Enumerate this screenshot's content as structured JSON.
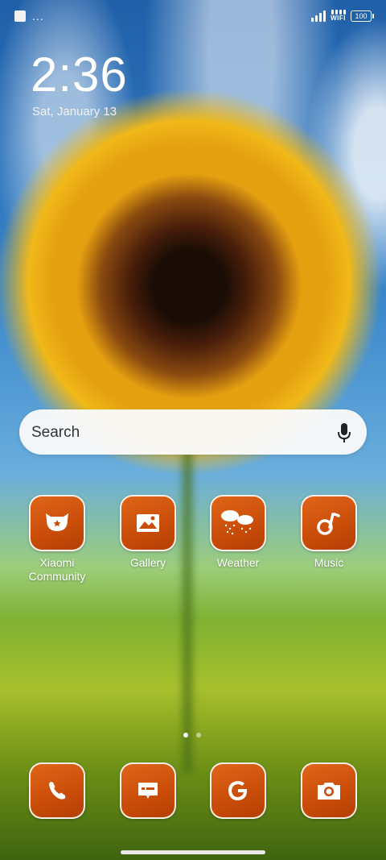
{
  "status_bar": {
    "left_dots": "...",
    "wifi_label": "WIFI",
    "battery_level": "100"
  },
  "lock": {
    "time": "2:36",
    "date": "Sat, January 13"
  },
  "search": {
    "placeholder": "Search",
    "icon": "mic-icon"
  },
  "apps": [
    {
      "label": "Xiaomi\nCommunity",
      "icon": "xiaomi-community-icon"
    },
    {
      "label": "Gallery",
      "icon": "gallery-icon"
    },
    {
      "label": "Weather",
      "icon": "weather-icon"
    },
    {
      "label": "Music",
      "icon": "music-icon"
    }
  ],
  "dock": [
    {
      "name": "Phone",
      "icon": "phone-icon"
    },
    {
      "name": "Messages",
      "icon": "messages-icon"
    },
    {
      "name": "Google",
      "icon": "google-icon"
    },
    {
      "name": "Camera",
      "icon": "camera-icon"
    }
  ],
  "pager": {
    "pages": 2,
    "active": 0
  },
  "colors": {
    "icon_bg": "#c94c08",
    "text": "#ffffff"
  }
}
